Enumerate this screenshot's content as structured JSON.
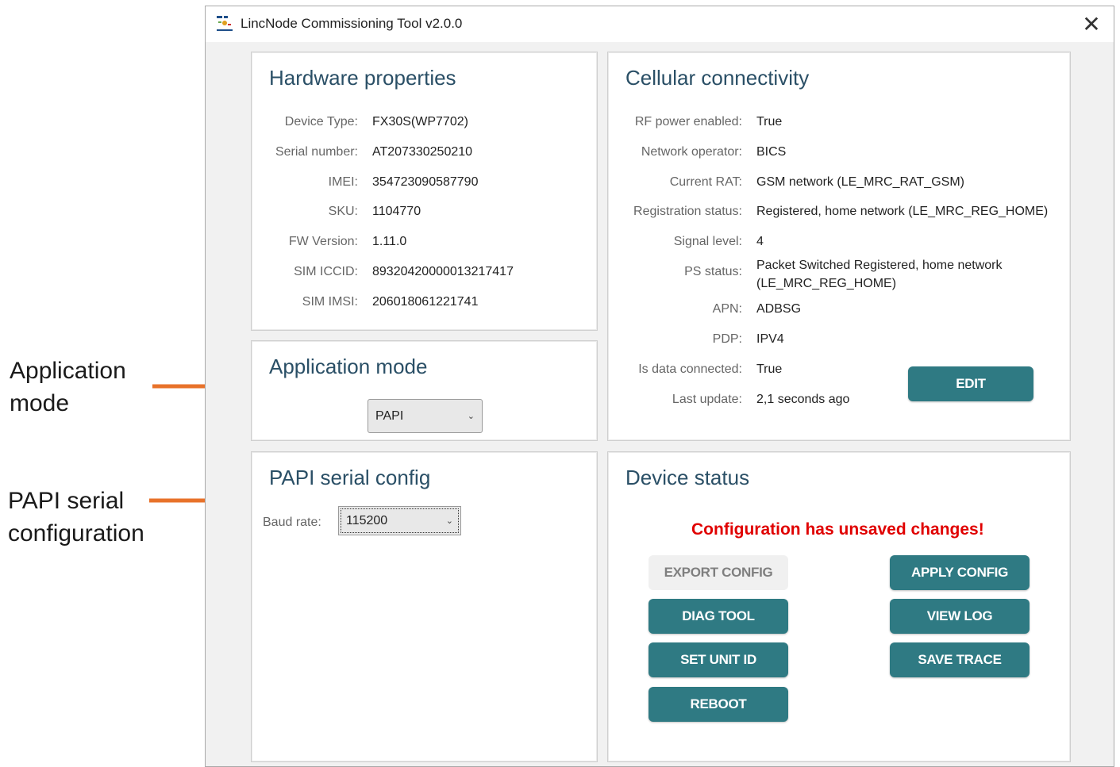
{
  "callouts": {
    "application_mode": [
      "Application",
      "mode"
    ],
    "papi_serial": [
      "PAPI serial",
      "configuration"
    ],
    "arrow_color": "#e8722a"
  },
  "window": {
    "title": "LincNode Commissioning Tool v2.0.0",
    "close_glyph": "✕"
  },
  "hardware": {
    "title": "Hardware properties",
    "rows": [
      {
        "label": "Device Type:",
        "value": "FX30S(WP7702)"
      },
      {
        "label": "Serial number:",
        "value": "AT207330250210"
      },
      {
        "label": "IMEI:",
        "value": "354723090587790"
      },
      {
        "label": "SKU:",
        "value": "1104770"
      },
      {
        "label": "FW Version:",
        "value": "1.11.0"
      },
      {
        "label": "SIM ICCID:",
        "value": "89320420000013217417"
      },
      {
        "label": "SIM IMSI:",
        "value": "206018061221741"
      }
    ]
  },
  "app_mode": {
    "title": "Application mode",
    "selected": "PAPI"
  },
  "papi_serial": {
    "title": "PAPI serial config",
    "baud_label": "Baud rate:",
    "baud_value": "115200"
  },
  "cellular": {
    "title": "Cellular connectivity",
    "rows": [
      {
        "label": "RF power enabled:",
        "value": "True"
      },
      {
        "label": "Network operator:",
        "value": "BICS"
      },
      {
        "label": "Current RAT:",
        "value": "GSM network (LE_MRC_RAT_GSM)"
      },
      {
        "label": "Registration status:",
        "value": "Registered, home network (LE_MRC_REG_HOME)"
      },
      {
        "label": "Signal level:",
        "value": "4"
      },
      {
        "label": "PS status:",
        "value": "Packet Switched Registered, home network",
        "value2": "(LE_MRC_REG_HOME)"
      },
      {
        "label": "APN:",
        "value": "ADBSG"
      },
      {
        "label": "PDP:",
        "value": "IPV4"
      },
      {
        "label": "Is data connected:",
        "value": "True"
      },
      {
        "label": "Last update:",
        "value": "2,1 seconds ago"
      }
    ],
    "edit_label": "EDIT"
  },
  "device_status": {
    "title": "Device status",
    "warning": "Configuration has unsaved changes!",
    "buttons": {
      "export_config": "EXPORT CONFIG",
      "apply_config": "APPLY CONFIG",
      "diag_tool": "DIAG TOOL",
      "view_log": "VIEW LOG",
      "set_unit_id": "SET UNIT ID",
      "save_trace": "SAVE TRACE",
      "reboot": "REBOOT"
    }
  },
  "colors": {
    "accent_button": "#2f7a83",
    "panel_title": "#2a4f66",
    "warning": "#e00000"
  }
}
